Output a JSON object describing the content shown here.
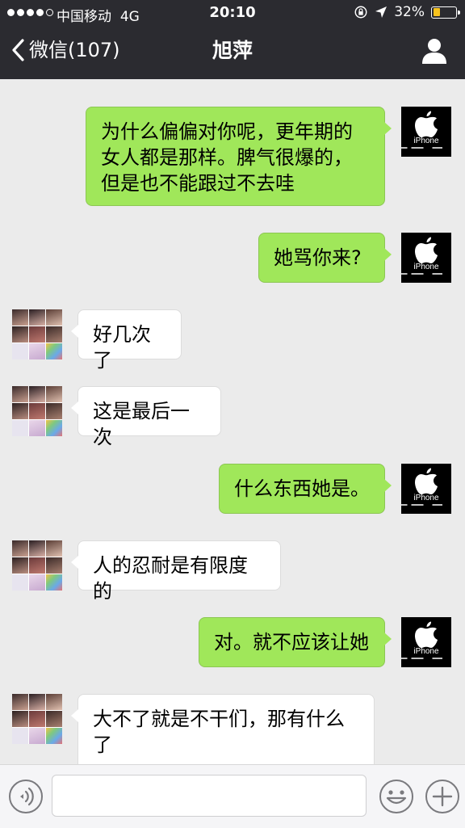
{
  "status_bar": {
    "carrier": "中国移动",
    "network": "4G",
    "time": "20:10",
    "battery_percent": "32%",
    "battery_level": 0.32,
    "battery_color": "#f8c31e"
  },
  "nav": {
    "back_label": "微信(107)",
    "title": "旭萍",
    "back_icon": "chevron-left-icon",
    "profile_icon": "person-icon"
  },
  "self_avatar_label": "iPhone",
  "messages": [
    {
      "side": "right",
      "text": "为什么偏偏对你呢，更年期的女人都是那样。脾气很爆的，但是也不能跟过不去哇"
    },
    {
      "side": "right",
      "text": "她骂你来?"
    },
    {
      "side": "left",
      "text": "好几次了"
    },
    {
      "side": "left",
      "text": "这是最后一次"
    },
    {
      "side": "right",
      "text": "什么东西她是。"
    },
    {
      "side": "left",
      "text": "人的忍耐是有限度的"
    },
    {
      "side": "right",
      "text": "对。就不应该让她"
    },
    {
      "side": "left",
      "text": "大不了就是不干们，那有什么了"
    }
  ],
  "input": {
    "value": "",
    "voice_icon": "voice-icon",
    "emoji_icon": "emoji-icon",
    "plus_icon": "plus-icon"
  },
  "colors": {
    "nav_bg": "#2b2b30",
    "chat_bg": "#ebebeb",
    "outgoing_bubble": "#a0e75a",
    "incoming_bubble": "#ffffff"
  }
}
